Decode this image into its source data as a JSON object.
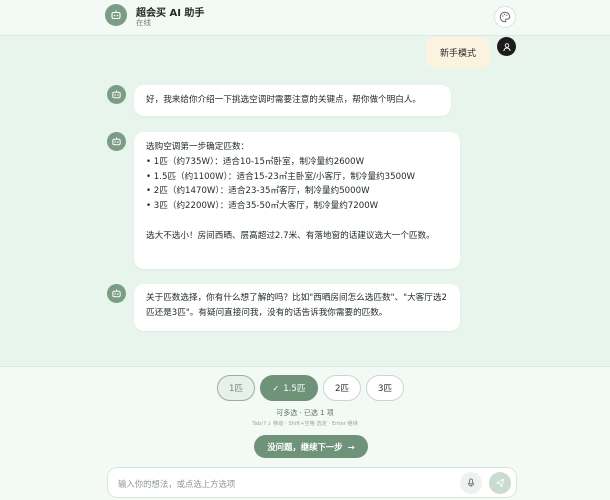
{
  "header": {
    "title": "超会买 AI 助手",
    "status": "在线",
    "avatar_icon": "robot-icon",
    "palette_icon": "palette-icon"
  },
  "messages": {
    "user_1": "新手模式",
    "bot_1": "好，我来给你介绍一下挑选空调时需要注意的关键点，帮你做个明白人。",
    "bot_2": {
      "intro": "选购空调第一步确定匹数：",
      "items": [
        "• 1匹（约735W）：适合10-15㎡卧室，制冷量约2600W",
        "• 1.5匹（约1100W）：适合15-23㎡主卧室/小客厅，制冷量约3500W",
        "• 2匹（约1470W）：适合23-35㎡客厅，制冷量约5000W",
        "• 3匹（约2200W）：适合35-50㎡大客厅，制冷量约7200W"
      ],
      "tip": "选大不选小！房间西晒、层高超过2.7米、有落地窗的话建议选大一个匹数。"
    },
    "bot_3": "关于匹数选择，你有什么想了解的吗？比如\"西晒房间怎么选匹数\"、\"大客厅选2匹还是3匹\"。有疑问直接问我，没有的话告诉我你需要的匹数。"
  },
  "options": {
    "chips": [
      {
        "label": "1匹",
        "state": "hover"
      },
      {
        "label": "1.5匹",
        "state": "selected"
      },
      {
        "label": "2匹",
        "state": "default"
      },
      {
        "label": "3匹",
        "state": "default"
      }
    ],
    "hint": "可多选 · 已选 1 项",
    "keyboard_hint": "Tab/↑↓ 移动 · Shift+空格 选定 · Enter 继续",
    "continue_label": "没问题，继续下一步",
    "continue_arrow": "→"
  },
  "composer": {
    "placeholder": "输入你的想法，或点选上方选项"
  },
  "colors": {
    "accent": "#6f9379",
    "background": "#e8f5ec",
    "user_bubble": "#fbf3df"
  }
}
